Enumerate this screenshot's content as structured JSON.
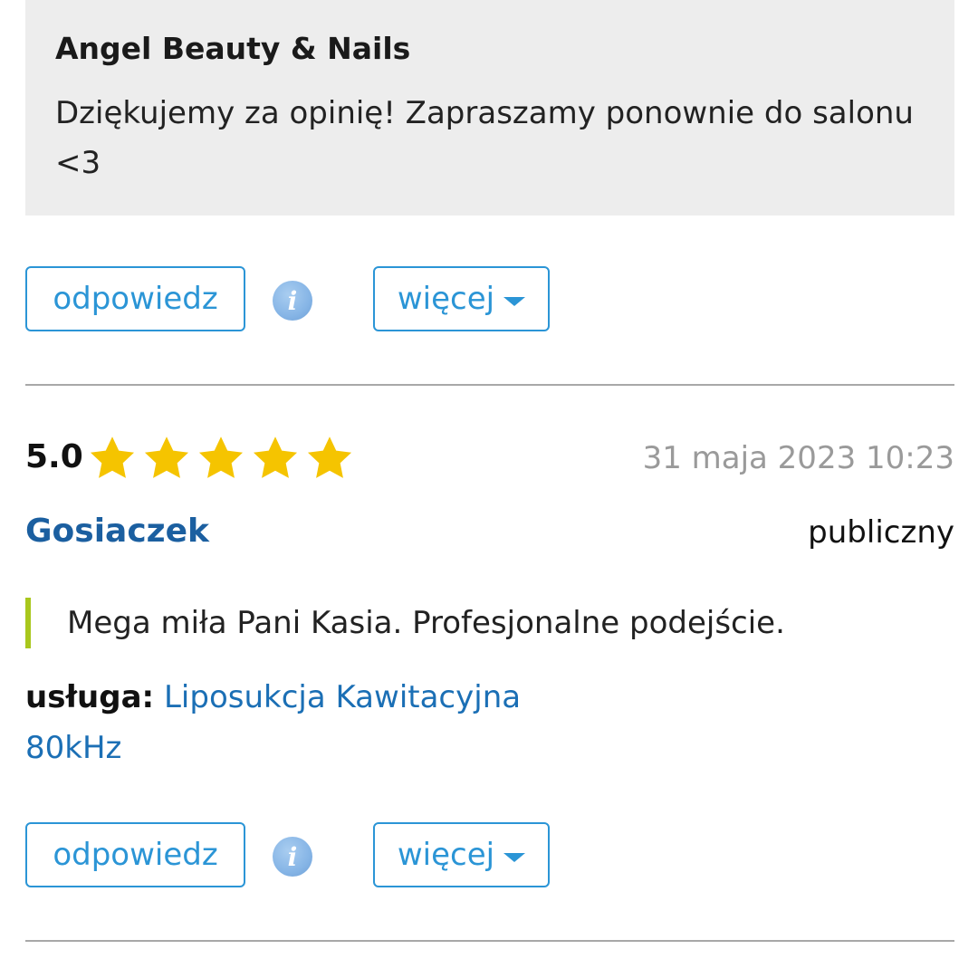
{
  "reply": {
    "author": "Angel Beauty & Nails",
    "text": "Dziękujemy za opinię! Zapraszamy ponownie do salonu <3"
  },
  "actions": {
    "reply_label": "odpowiedz",
    "more_label": "więcej",
    "info_glyph": "i"
  },
  "review": {
    "rating": "5.0",
    "stars": 5,
    "date": "31 maja 2023 10:23",
    "author": "Gosiaczek",
    "visibility": "publiczny",
    "text": "Mega miła Pani Kasia. Profesjonalne podejście.",
    "service_label": "usługa:",
    "service_name": "Liposukcja Kawitacyjna 80kHz"
  },
  "colors": {
    "accent": "#2b95d6",
    "star": "#f5c400",
    "quote_bar": "#a9c71d",
    "author_link": "#1b5fa0"
  }
}
